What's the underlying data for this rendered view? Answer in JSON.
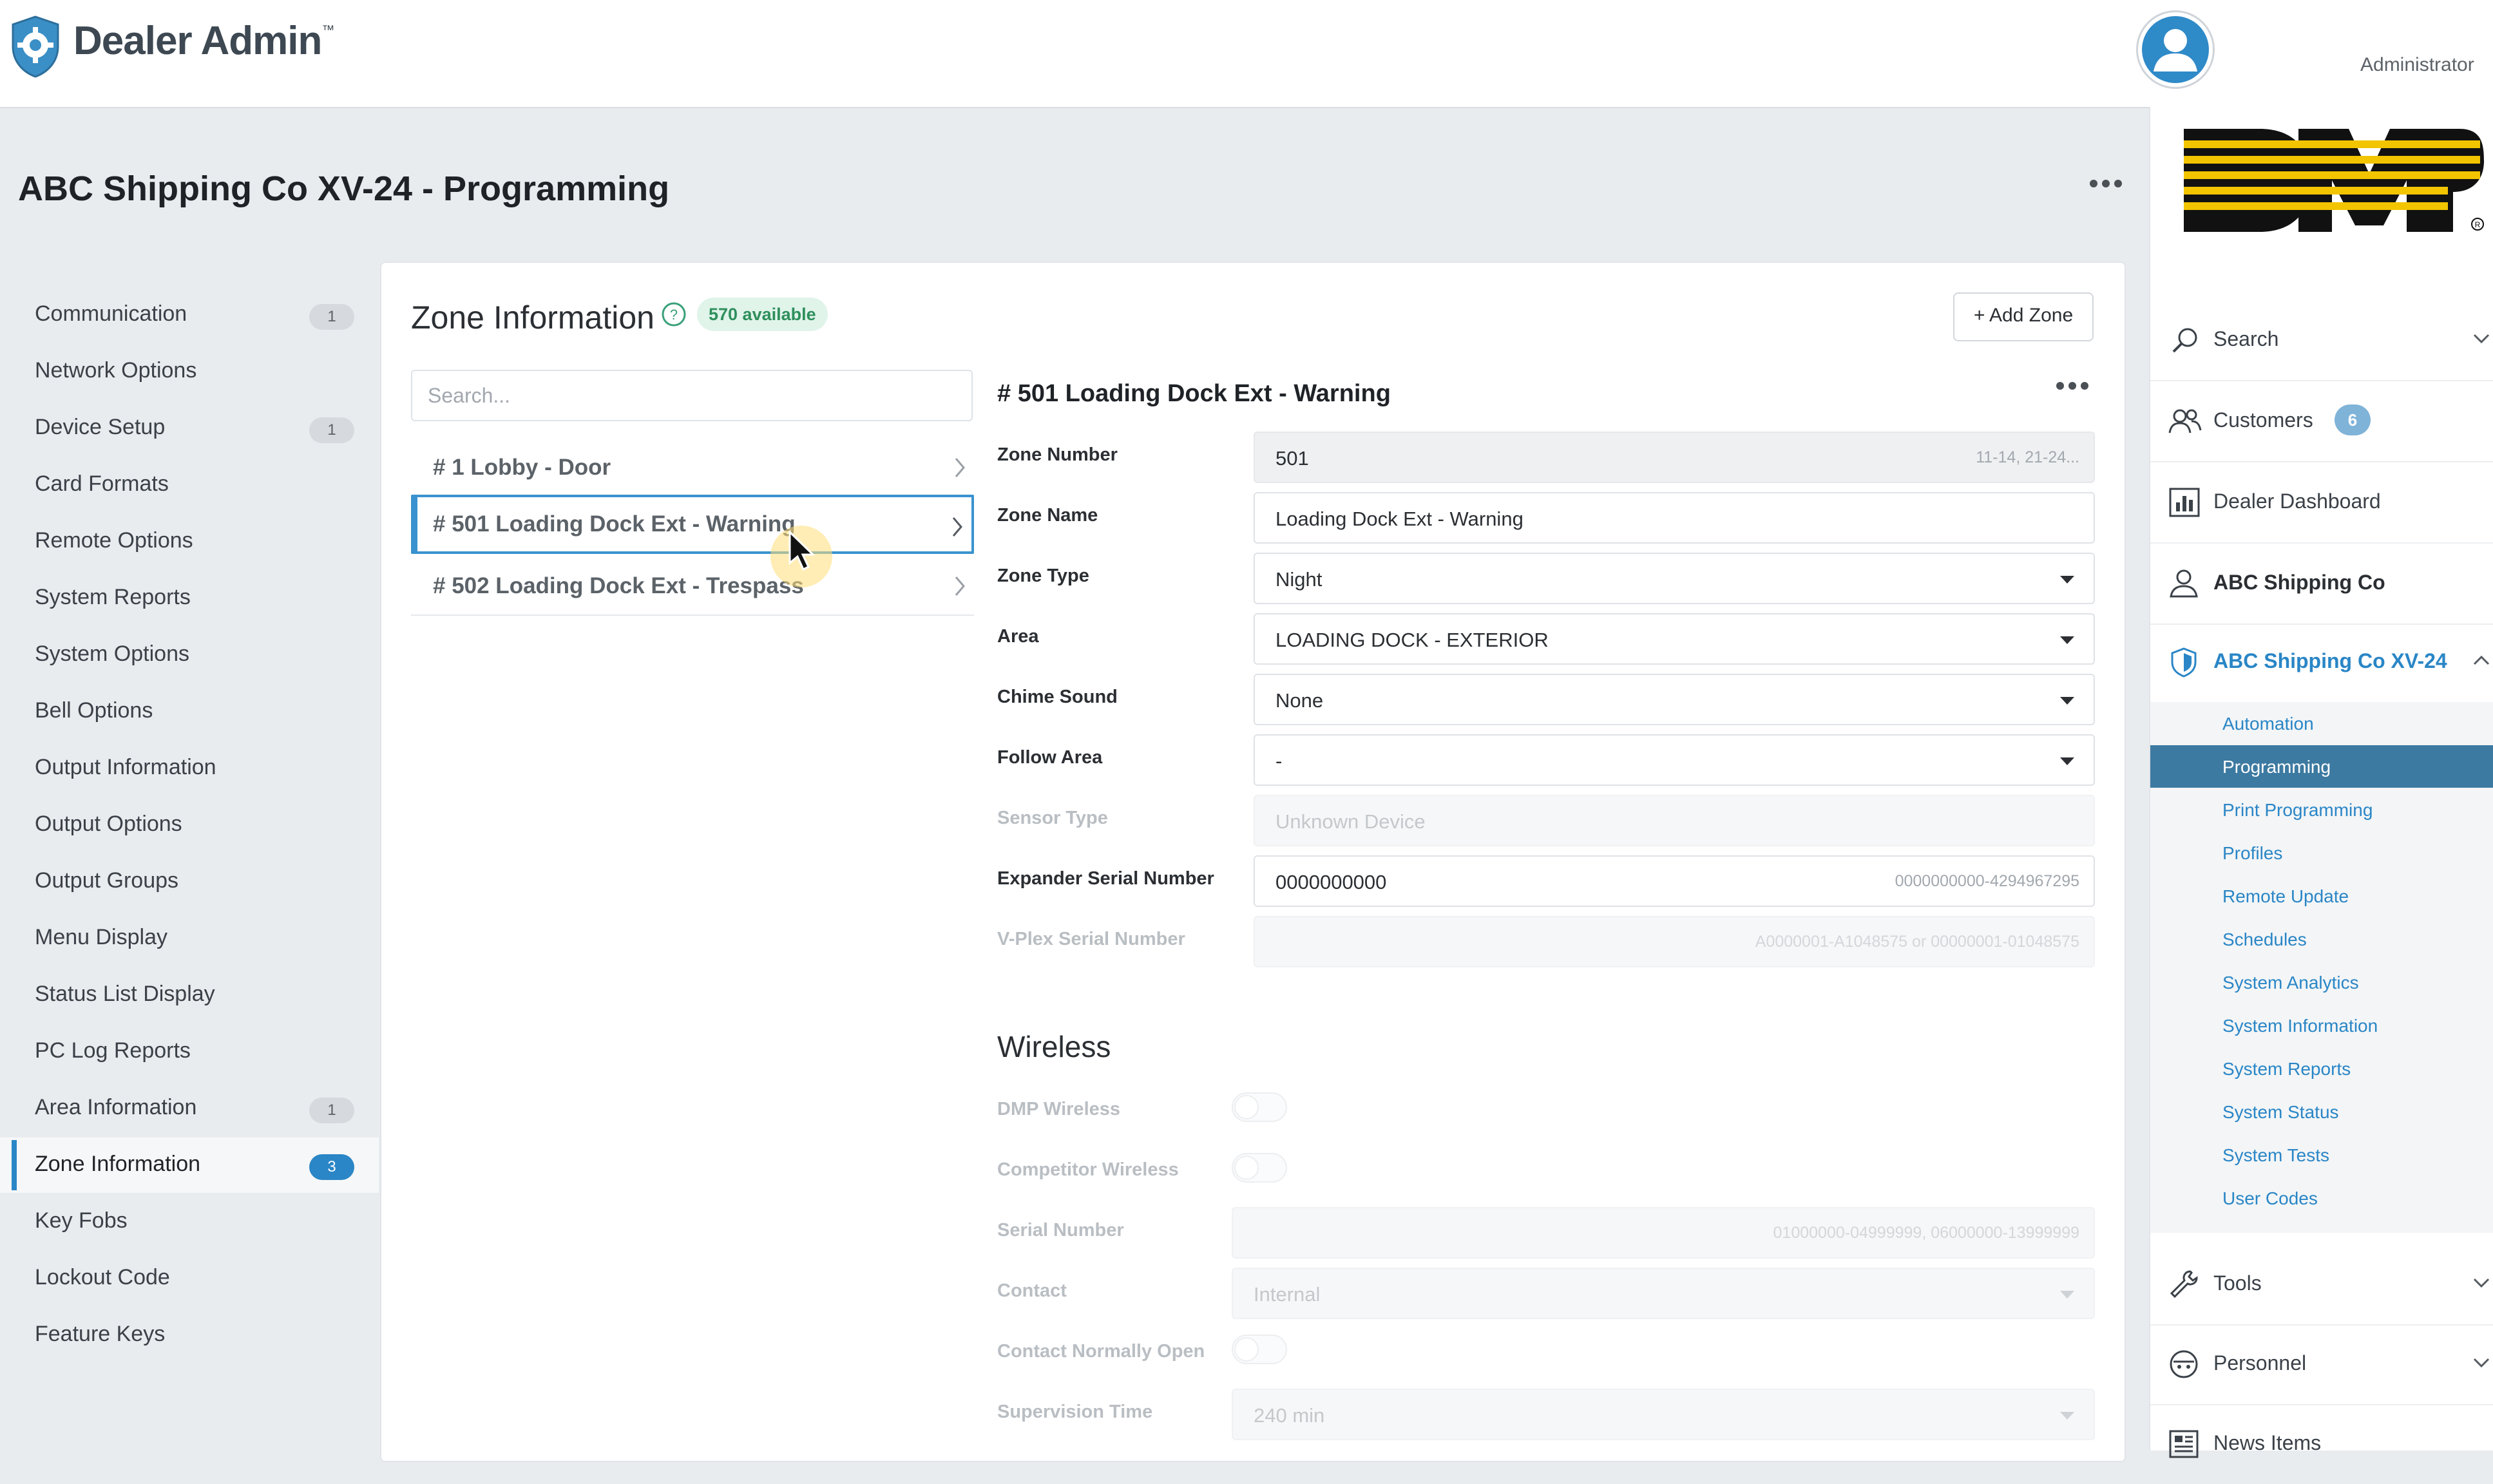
{
  "app": {
    "brand": "Dealer Admin",
    "brand_tm": "™",
    "user_label": "Administrator"
  },
  "page": {
    "title": "ABC Shipping Co XV-24 - Programming"
  },
  "left_nav": [
    {
      "label": "Communication",
      "badge": "1"
    },
    {
      "label": "Network Options",
      "badge": ""
    },
    {
      "label": "Device Setup",
      "badge": "1"
    },
    {
      "label": "Card Formats",
      "badge": ""
    },
    {
      "label": "Remote Options",
      "badge": ""
    },
    {
      "label": "System Reports",
      "badge": ""
    },
    {
      "label": "System Options",
      "badge": ""
    },
    {
      "label": "Bell Options",
      "badge": ""
    },
    {
      "label": "Output Information",
      "badge": ""
    },
    {
      "label": "Output Options",
      "badge": ""
    },
    {
      "label": "Output Groups",
      "badge": ""
    },
    {
      "label": "Menu Display",
      "badge": ""
    },
    {
      "label": "Status List Display",
      "badge": ""
    },
    {
      "label": "PC Log Reports",
      "badge": ""
    },
    {
      "label": "Area Information",
      "badge": "1"
    },
    {
      "label": "Zone Information",
      "badge": "3",
      "active": true
    },
    {
      "label": "Key Fobs",
      "badge": ""
    },
    {
      "label": "Lockout Code",
      "badge": ""
    },
    {
      "label": "Feature Keys",
      "badge": ""
    }
  ],
  "zone_info": {
    "title": "Zone Information",
    "available_badge": "570 available",
    "add_button": "+ Add Zone",
    "search_placeholder": "Search...",
    "zones": [
      {
        "label": "# 1 Lobby - Door"
      },
      {
        "label": "# 501 Loading Dock Ext - Warning",
        "selected": true
      },
      {
        "label": "# 502 Loading Dock Ext - Trespass"
      }
    ]
  },
  "detail": {
    "title": "# 501 Loading Dock Ext - Warning",
    "fields": {
      "zone_number": {
        "label": "Zone Number",
        "value": "501",
        "hint": "11-14, 21-24..."
      },
      "zone_name": {
        "label": "Zone Name",
        "value": "Loading Dock Ext - Warning"
      },
      "zone_type": {
        "label": "Zone Type",
        "value": "Night"
      },
      "area": {
        "label": "Area",
        "value": "LOADING DOCK - EXTERIOR"
      },
      "chime_sound": {
        "label": "Chime Sound",
        "value": "None"
      },
      "follow_area": {
        "label": "Follow Area",
        "value": "-"
      },
      "sensor_type": {
        "label": "Sensor Type",
        "value": "Unknown Device"
      },
      "expander_serial": {
        "label": "Expander Serial Number",
        "value": "0000000000",
        "hint": "0000000000-4294967295"
      },
      "vplex_serial": {
        "label": "V-Plex Serial Number",
        "value": "",
        "hint": "A0000001-A1048575 or 00000001-01048575"
      }
    },
    "wireless": {
      "heading": "Wireless",
      "dmp_wireless": {
        "label": "DMP Wireless",
        "on": false
      },
      "competitor_wireless": {
        "label": "Competitor Wireless",
        "on": false
      },
      "serial_number": {
        "label": "Serial Number",
        "hint": "01000000-04999999, 06000000-13999999"
      },
      "contact": {
        "label": "Contact",
        "value": "Internal"
      },
      "contact_normally_open": {
        "label": "Contact Normally Open",
        "on": false
      },
      "supervision_time": {
        "label": "Supervision Time",
        "value": "240 min"
      }
    }
  },
  "right_sidebar": {
    "search": "Search",
    "customers": "Customers",
    "customers_count": "6",
    "dealer_dashboard": "Dealer Dashboard",
    "customer_name": "ABC Shipping Co",
    "system_name": "ABC Shipping Co XV-24",
    "system_sub": [
      "Automation",
      "Programming",
      "Print Programming",
      "Profiles",
      "Remote Update",
      "Schedules",
      "System Analytics",
      "System Information",
      "System Reports",
      "System Status",
      "System Tests",
      "User Codes"
    ],
    "tools": "Tools",
    "personnel": "Personnel",
    "news_items": "News Items"
  },
  "colors": {
    "accent": "#2a86c6",
    "active_sub_bg": "#3d7aa1",
    "badge_green_bg": "#e0f4ea",
    "badge_green_text": "#2f8f5c",
    "dmp_yellow": "#f2c500"
  },
  "icons": [
    "shield-gear-icon",
    "user-avatar-icon",
    "more-dots-icon",
    "help-circle-icon",
    "chevron-right-icon",
    "caret-down-icon",
    "search-icon",
    "customers-icon",
    "dashboard-icon",
    "person-icon",
    "shield-icon",
    "wrench-icon",
    "personnel-icon",
    "news-icon",
    "chevron-down-icon",
    "chevron-up-icon",
    "mouse-cursor-icon"
  ]
}
